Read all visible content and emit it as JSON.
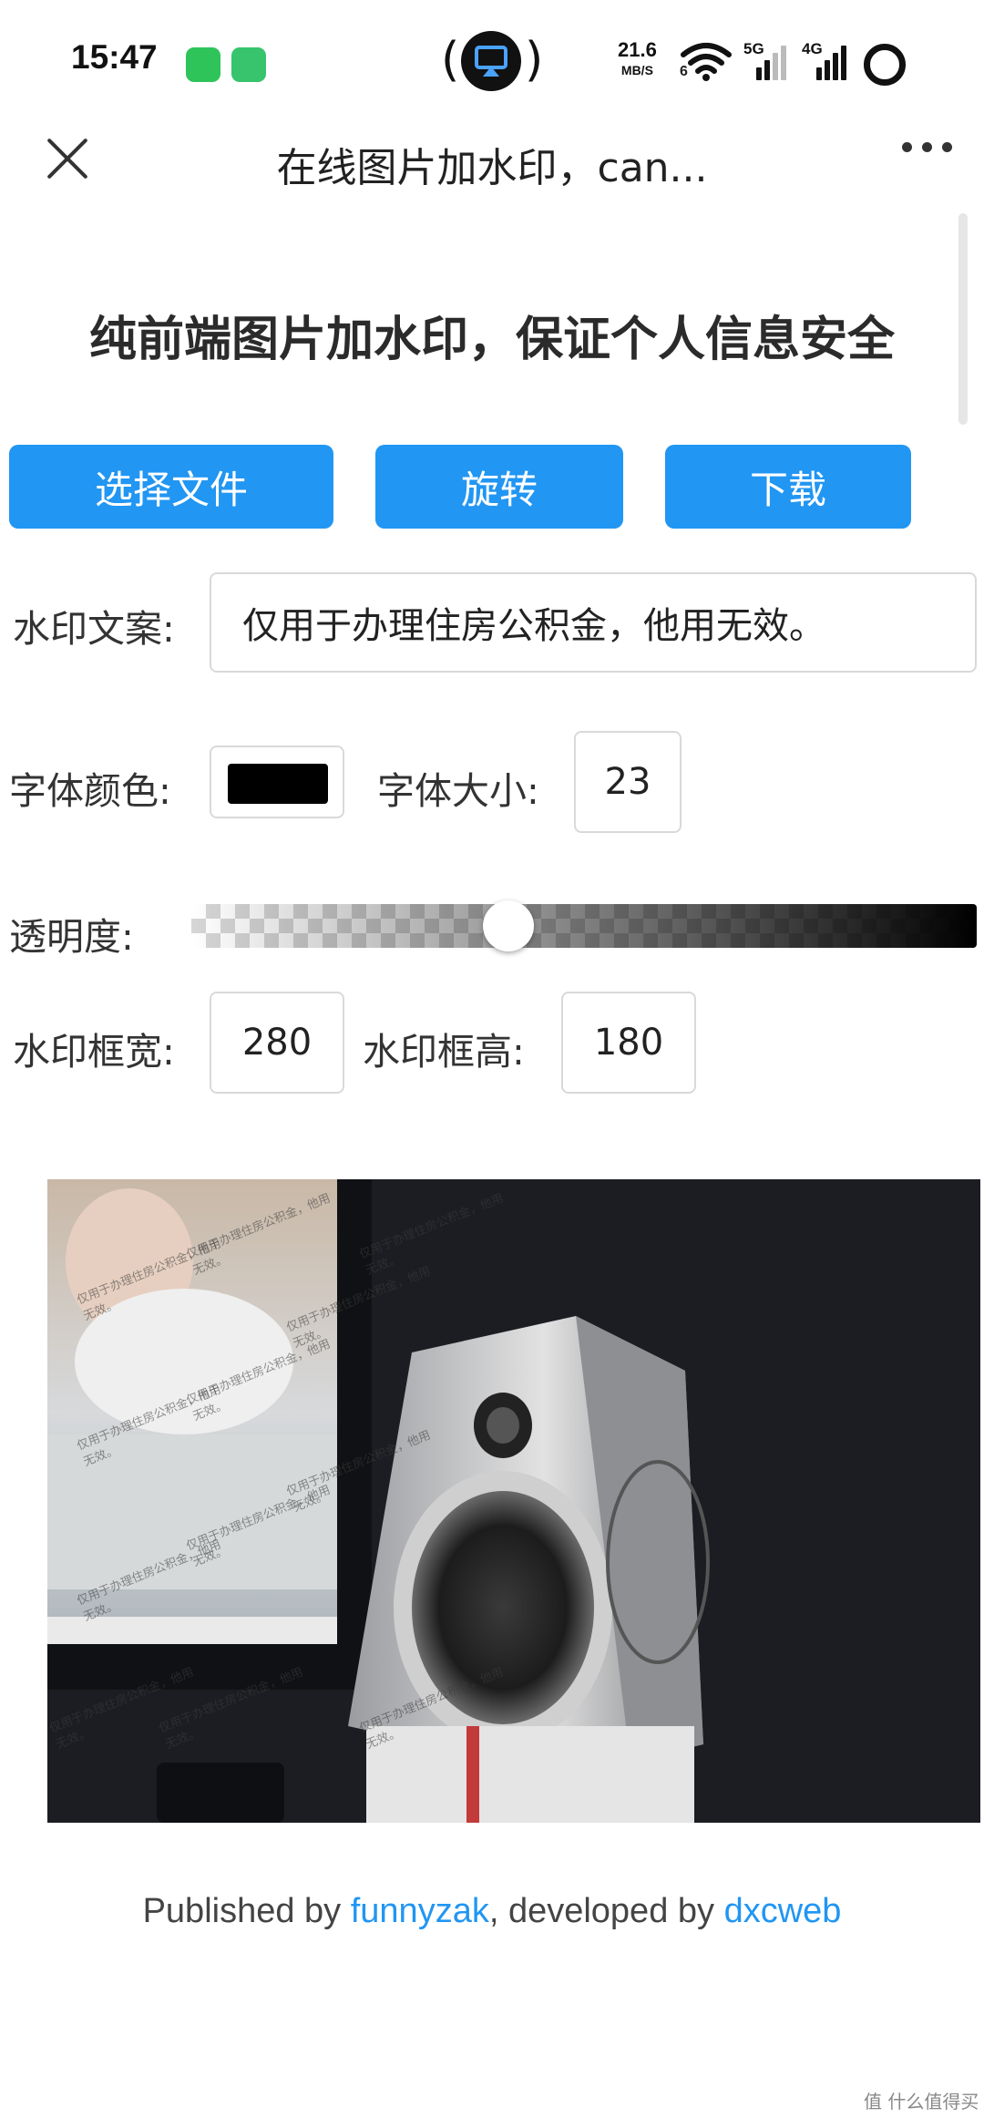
{
  "status_bar": {
    "time": "15:47",
    "net_speed": "21.6",
    "net_speed_unit": "MB/S",
    "wifi_tag": "6",
    "sim1_tag": "5G",
    "sim2_tag": "4G"
  },
  "nav": {
    "title": "在线图片加水印，can..."
  },
  "page": {
    "heading": "纯前端图片加水印，保证个人信息安全"
  },
  "buttons": {
    "choose_file": "选择文件",
    "rotate": "旋转",
    "download": "下载"
  },
  "form": {
    "watermark_text_label": "水印文案:",
    "watermark_text_value": "仅用于办理住房公积金，他用无效。",
    "font_color_label": "字体颜色:",
    "font_color_value": "#000000",
    "font_size_label": "字体大小:",
    "font_size_value": "23",
    "opacity_label": "透明度:",
    "opacity_value": 0.4,
    "box_width_label": "水印框宽:",
    "box_width_value": "280",
    "box_height_label": "水印框高:",
    "box_height_value": "180"
  },
  "preview": {
    "watermark_line1": "仅用于办理住房公积金，他用",
    "watermark_line2": "无效。"
  },
  "footer": {
    "published_prefix": "Published by ",
    "publisher": "funnyzak",
    "developed_prefix": ", developed by ",
    "developer": "dxcweb"
  },
  "corner_brand": "值 什么值得买",
  "colors": {
    "primary": "#2196f3",
    "link": "#2196f3"
  }
}
